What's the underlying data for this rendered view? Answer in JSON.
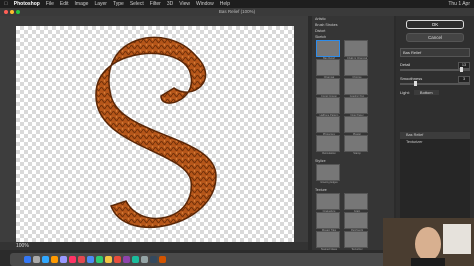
{
  "menubar": {
    "app": "Photoshop",
    "items": [
      "File",
      "Edit",
      "Image",
      "Layer",
      "Type",
      "Select",
      "Filter",
      "3D",
      "View",
      "Window",
      "Help"
    ],
    "datetime": "Thu 1 Apr"
  },
  "dialog": {
    "title": "Bas Relief (100%)"
  },
  "zoom": {
    "value": "100%"
  },
  "gallery": {
    "folders": [
      "Artistic",
      "Brush Strokes",
      "Distort",
      "Sketch",
      "Stylize",
      "Texture"
    ],
    "sketch_thumbs": [
      "Bas Relief",
      "Chalk & Charcoal",
      "Charcoal",
      "Chrome",
      "Conté Crayon",
      "Graphic Pen",
      "Halftone Pattern",
      "Note Paper",
      "Photocopy",
      "Plaster",
      "Reticulation",
      "Stamp",
      "Torn Edges",
      "Water Paper"
    ],
    "stylize_thumbs": [
      "Glowing Edges"
    ],
    "texture_thumbs": [
      "Craquelure",
      "Grain",
      "Mosaic Tiles",
      "Patchwork",
      "Stained Glass",
      "Texturizer"
    ]
  },
  "settings": {
    "ok": "OK",
    "cancel": "Cancel",
    "filter": "Bas Relief",
    "params": [
      {
        "label": "Detail",
        "value": "13",
        "fraction": 0.85
      },
      {
        "label": "Smoothness",
        "value": "3",
        "fraction": 0.2
      }
    ],
    "light_label": "Light:",
    "light_value": "Bottom"
  },
  "layers": [
    "Bas Relief",
    "Texturizer"
  ],
  "colors": {
    "accent": "#2d8ceb",
    "letter": "#b5561a"
  }
}
